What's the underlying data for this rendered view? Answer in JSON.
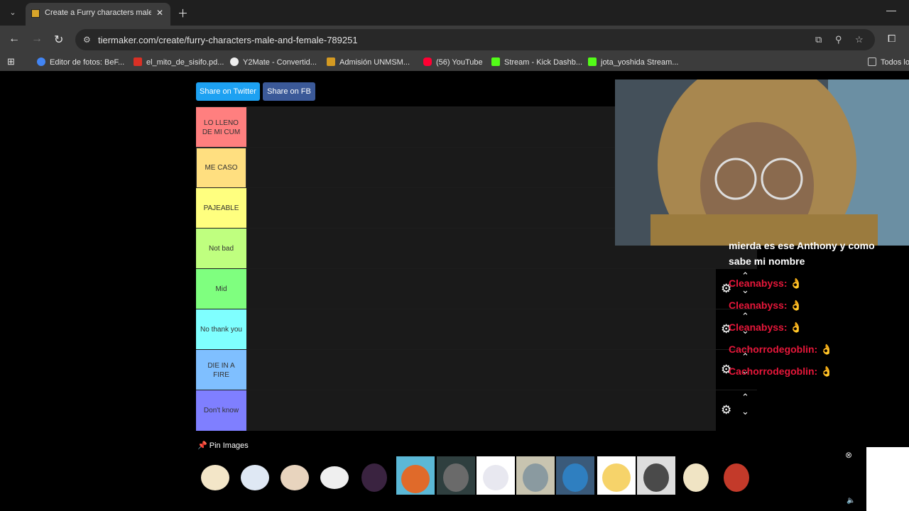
{
  "browser": {
    "tab_title": "Create a Furry characters male and female",
    "url": "tiermaker.com/create/furry-characters-male-and-female-789251"
  },
  "bookmarks": [
    {
      "label": "Editor de fotos: BeF...",
      "icon": "google-icon",
      "color": "#4285f4"
    },
    {
      "label": "el_mito_de_sisifo.pd...",
      "icon": "pdf-icon",
      "color": "#d93025"
    },
    {
      "label": "Y2Mate - Convertid...",
      "icon": "y2mate-icon",
      "color": "#666666"
    },
    {
      "label": "Admisión UNMSM...",
      "icon": "unmsm-icon",
      "color": "#d49a22"
    },
    {
      "label": "(56) YouTube",
      "icon": "youtube-icon",
      "color": "#ff0033"
    },
    {
      "label": "Stream - Kick Dashb...",
      "icon": "kick-icon",
      "color": "#53fc18"
    },
    {
      "label": "jota_yoshida Stream...",
      "icon": "kick-icon",
      "color": "#53fc18"
    },
    {
      "label": "Todos lo",
      "icon": "folder-icon",
      "color": "#c7c7c7"
    }
  ],
  "share": {
    "twitter": "Share on Twitter",
    "fb": "Share on FB"
  },
  "tiers": [
    {
      "label": "LO LLENO DE MI CUM",
      "color": "#ff7f7f"
    },
    {
      "label": "ME CASO",
      "color": "#ffdf80"
    },
    {
      "label": "PAJEABLE",
      "color": "#ffff7f"
    },
    {
      "label": "Not bad",
      "color": "#bfff7f"
    },
    {
      "label": "Mid",
      "color": "#7fff7f"
    },
    {
      "label": "No thank you",
      "color": "#7fffff"
    },
    {
      "label": "DIE IN A FIRE",
      "color": "#7fbfff"
    },
    {
      "label": "Don't know",
      "color": "#7f7fff"
    }
  ],
  "chat": [
    {
      "user": "",
      "text": "mierda es ese Anthony y como"
    },
    {
      "user": "",
      "text": "sabe mi nombre"
    },
    {
      "user": "Cleanabyss:",
      "text": ""
    },
    {
      "user": "Cleanabyss:",
      "text": ""
    },
    {
      "user": "Cleanabyss:",
      "text": ""
    },
    {
      "user": "Cachorrodegoblin:",
      "text": ""
    },
    {
      "user": "Cachorrodegoblin:",
      "text": ""
    }
  ],
  "pin_label": "Pin Images",
  "thumb_colors": [
    "#f3e6c8",
    "#dfe8f4",
    "#e8d4be",
    "#efefef",
    "#3a2340",
    "#e06a2a",
    "#6a6a6a",
    "#f1f1f1",
    "#8a9aa0",
    "#2f7fc0",
    "#f6d36a",
    "#4a4a4a",
    "#f0e4c4",
    "#c33a2a"
  ]
}
